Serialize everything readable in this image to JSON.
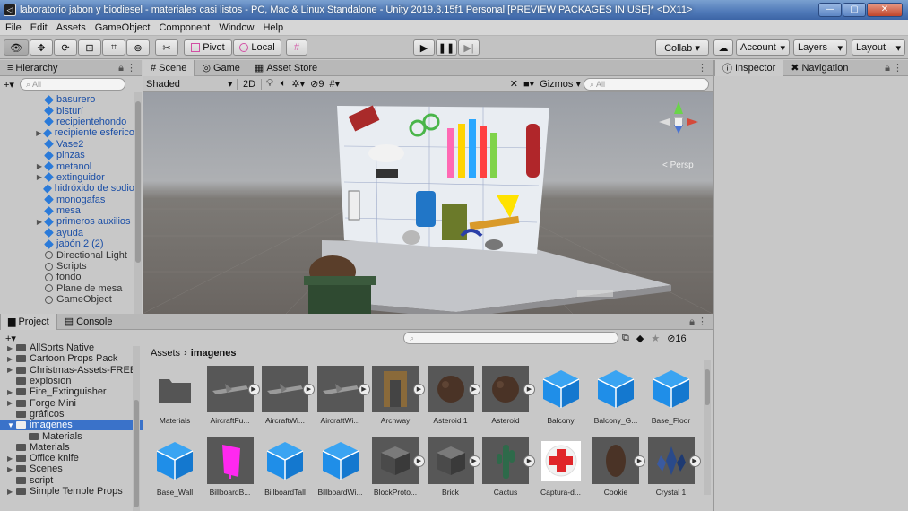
{
  "window": {
    "title": "laboratorio jabon y biodiesel - materiales casi listos - PC, Mac & Linux Standalone - Unity 2019.3.15f1 Personal [PREVIEW PACKAGES IN USE]* <DX11>",
    "app_icon": "unity-icon"
  },
  "menu": [
    "File",
    "Edit",
    "Assets",
    "GameObject",
    "Component",
    "Window",
    "Help"
  ],
  "toolbar": {
    "pivot": "Pivot",
    "local": "Local",
    "collab": "Collab ▾",
    "account": "Account",
    "layers": "Layers",
    "layout": "Layout"
  },
  "hierarchy": {
    "tab": "Hierarchy",
    "add": "+▾",
    "search_placeholder": "All",
    "items": [
      {
        "label": "basurero",
        "type": "prefab",
        "expand": false
      },
      {
        "label": "bisturí",
        "type": "prefab",
        "expand": false
      },
      {
        "label": "recipientehondo",
        "type": "prefab",
        "expand": false
      },
      {
        "label": "recipiente esferico",
        "type": "prefab",
        "expand": true
      },
      {
        "label": "Vase2",
        "type": "prefab",
        "expand": false
      },
      {
        "label": "pinzas",
        "type": "prefab",
        "expand": false
      },
      {
        "label": "metanol",
        "type": "prefab",
        "expand": true
      },
      {
        "label": "extinguidor",
        "type": "prefab",
        "expand": true
      },
      {
        "label": "hidróxido de sodio",
        "type": "prefab",
        "expand": false
      },
      {
        "label": "monogafas",
        "type": "prefab",
        "expand": false
      },
      {
        "label": "mesa",
        "type": "prefab",
        "expand": false
      },
      {
        "label": "primeros auxilios",
        "type": "prefab",
        "expand": true
      },
      {
        "label": "ayuda",
        "type": "prefab",
        "expand": false
      },
      {
        "label": "jabón 2 (2)",
        "type": "prefab",
        "expand": false
      },
      {
        "label": "Directional Light",
        "type": "object",
        "expand": false
      },
      {
        "label": "Scripts",
        "type": "object",
        "expand": false
      },
      {
        "label": "fondo",
        "type": "object",
        "expand": false
      },
      {
        "label": "Plane de mesa",
        "type": "object",
        "expand": false
      },
      {
        "label": "GameObject",
        "type": "object",
        "expand": false
      }
    ]
  },
  "scene": {
    "tabs": [
      "Scene",
      "Game",
      "Asset Store"
    ],
    "shading": "Shaded",
    "mode_2d": "2D",
    "hidden_count": "9",
    "gizmos": "Gizmos",
    "search_placeholder": "All",
    "persp_label": "< Persp"
  },
  "inspector": {
    "tabs": [
      "Inspector",
      "Navigation"
    ]
  },
  "project": {
    "tabs": [
      "Project",
      "Console"
    ],
    "add": "+▾",
    "hidden_count": "16",
    "tree": [
      {
        "label": "AllSorts Native",
        "indent": 1,
        "expand": true
      },
      {
        "label": "Cartoon Props Pack",
        "indent": 1,
        "expand": true
      },
      {
        "label": "Christmas-Assets-FREE",
        "indent": 1,
        "expand": true
      },
      {
        "label": "explosion",
        "indent": 1,
        "expand": false
      },
      {
        "label": "Fire_Extinguisher",
        "indent": 1,
        "expand": true
      },
      {
        "label": "Forge Mini",
        "indent": 1,
        "expand": true
      },
      {
        "label": "gráficos",
        "indent": 1,
        "expand": false
      },
      {
        "label": "imagenes",
        "indent": 1,
        "expand": true,
        "selected": true
      },
      {
        "label": "Materials",
        "indent": 2,
        "expand": false
      },
      {
        "label": "Materials",
        "indent": 1,
        "expand": false
      },
      {
        "label": "Office knife",
        "indent": 1,
        "expand": true
      },
      {
        "label": "Scenes",
        "indent": 1,
        "expand": true
      },
      {
        "label": "script",
        "indent": 1,
        "expand": false
      },
      {
        "label": "Simple Temple Props",
        "indent": 1,
        "expand": true
      }
    ],
    "breadcrumb_root": "Assets",
    "breadcrumb_current": "imagenes",
    "assets_row1": [
      {
        "label": "Materials",
        "kind": "folder"
      },
      {
        "label": "AircraftFu...",
        "kind": "model-dark"
      },
      {
        "label": "AircraftWi...",
        "kind": "model-dark"
      },
      {
        "label": "AircraftWi...",
        "kind": "model-dark"
      },
      {
        "label": "Archway",
        "kind": "arch"
      },
      {
        "label": "Asteroid 1",
        "kind": "rock"
      },
      {
        "label": "Asteroid",
        "kind": "rock"
      },
      {
        "label": "Balcony",
        "kind": "prefab"
      },
      {
        "label": "Balcony_G...",
        "kind": "prefab"
      },
      {
        "label": "Base_Floor",
        "kind": "prefab"
      }
    ],
    "assets_row2": [
      {
        "label": "Base_Wall",
        "kind": "prefab"
      },
      {
        "label": "BillboardB...",
        "kind": "billboard"
      },
      {
        "label": "BillboardTall",
        "kind": "prefab"
      },
      {
        "label": "BillboardWi...",
        "kind": "prefab"
      },
      {
        "label": "BlockProto...",
        "kind": "block"
      },
      {
        "label": "Brick",
        "kind": "block"
      },
      {
        "label": "Cactus",
        "kind": "cactus"
      },
      {
        "label": "Captura-d...",
        "kind": "image-cross"
      },
      {
        "label": "Cookie",
        "kind": "cookie"
      },
      {
        "label": "Crystal 1",
        "kind": "crystal"
      }
    ]
  },
  "colors": {
    "accent": "#3a72c9",
    "prefab_blue": "#1a4ea6",
    "unity_cube": "#1f8ee8"
  }
}
